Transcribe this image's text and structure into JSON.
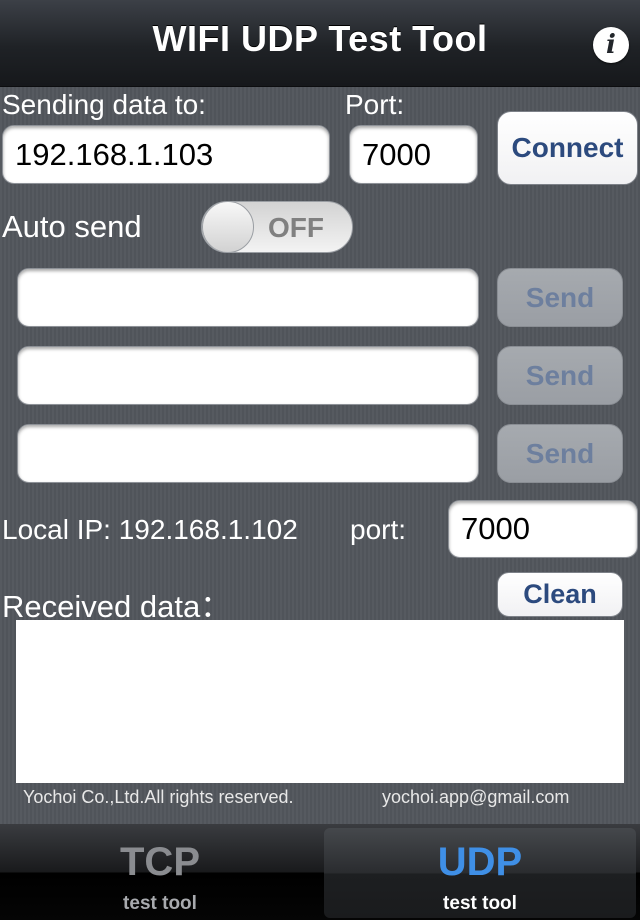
{
  "nav": {
    "title": "WIFI UDP Test Tool",
    "info_icon": "i"
  },
  "sending": {
    "label": "Sending data to:",
    "ip": "192.168.1.103",
    "port_label": "Port:",
    "port": "7000",
    "connect_label": "Connect"
  },
  "auto_send": {
    "label": "Auto send",
    "state": "OFF"
  },
  "messages": [
    {
      "value": "",
      "send_label": "Send"
    },
    {
      "value": "",
      "send_label": "Send"
    },
    {
      "value": "",
      "send_label": "Send"
    }
  ],
  "local": {
    "ip_text": "Local IP: 192.168.1.102",
    "port_label": "port:",
    "port": "7000"
  },
  "received": {
    "label": "Received data：",
    "clean_label": "Clean",
    "content": ""
  },
  "footer": {
    "copyright": "Yochoi Co.,Ltd.All rights reserved.",
    "email": "yochoi.app@gmail.com"
  },
  "tabs": [
    {
      "icon_text": "TCP",
      "label": "test tool",
      "selected": false
    },
    {
      "icon_text": "UDP",
      "label": "test tool",
      "selected": true
    }
  ],
  "colors": {
    "accent_blue": "#2c4a7e",
    "udp_blue": "#3f8fe6",
    "background": "#52565c"
  }
}
